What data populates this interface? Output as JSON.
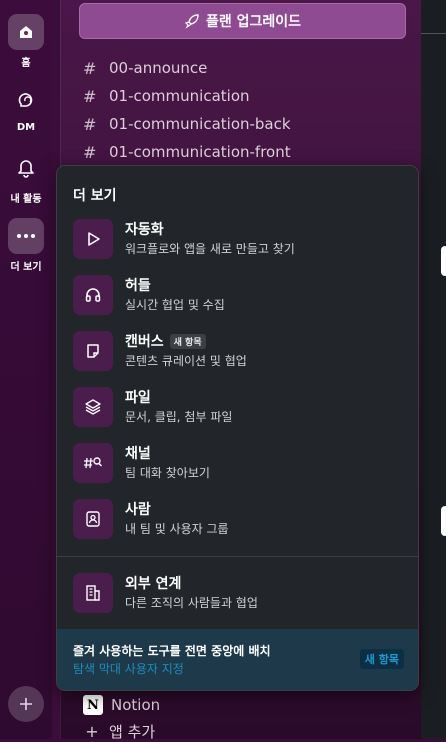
{
  "rail": {
    "items": [
      {
        "label": "홈",
        "icon": "home-icon"
      },
      {
        "label": "DM",
        "icon": "dm-icon"
      },
      {
        "label": "내 활동",
        "icon": "bell-icon"
      },
      {
        "label": "더 보기",
        "icon": "more-icon"
      }
    ]
  },
  "panel": {
    "upgrade_label": "플랜 업그레이드",
    "channels": [
      "00-announce",
      "01-communication",
      "01-communication-back",
      "01-communication-front"
    ],
    "apps": [
      {
        "label": "Notion",
        "icon": "notion-icon"
      },
      {
        "label": "앱 추가",
        "icon": "plus-icon"
      }
    ]
  },
  "more_menu": {
    "title": "더 보기",
    "items": [
      {
        "title": "자동화",
        "desc": "워크플로와 앱을 새로 만들고 찾기",
        "icon": "play-icon"
      },
      {
        "title": "허들",
        "desc": "실시간 협업 및 수집",
        "icon": "headphones-icon"
      },
      {
        "title": "캔버스",
        "badge": "새 항목",
        "desc": "콘텐츠 큐레이션 및 협업",
        "icon": "canvas-icon"
      },
      {
        "title": "파일",
        "desc": "문서, 클립, 첨부 파일",
        "icon": "layers-icon"
      },
      {
        "title": "채널",
        "desc": "팀 대화 찾아보기",
        "icon": "channel-search-icon"
      },
      {
        "title": "사람",
        "desc": "내 팀 및 사용자 그룹",
        "icon": "people-icon"
      },
      {
        "title": "외부 연계",
        "desc": "다른 조직의 사람들과 협업",
        "icon": "building-icon"
      }
    ],
    "promo": {
      "title": "즐겨 사용하는 도구를 전면 중앙에 배치",
      "subtitle": "탐색 막대 사용자 지정",
      "badge": "새 항목"
    }
  }
}
